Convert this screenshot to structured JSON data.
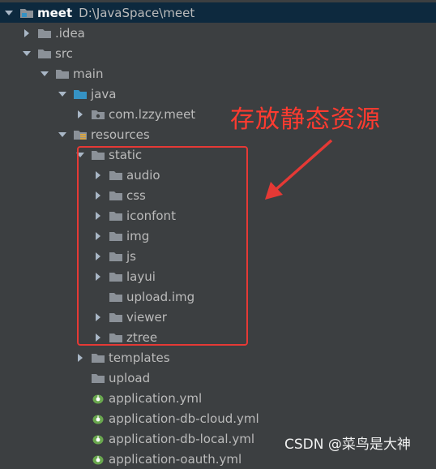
{
  "tree": {
    "items": [
      {
        "label": "meet",
        "path": "D:\\JavaSpace\\meet",
        "level": 0,
        "arrow": "down",
        "icon": "project-folder-icon",
        "root": true
      },
      {
        "label": ".idea",
        "level": 1,
        "arrow": "right",
        "icon": "folder-icon"
      },
      {
        "label": "src",
        "level": 1,
        "arrow": "down",
        "icon": "folder-icon"
      },
      {
        "label": "main",
        "level": 2,
        "arrow": "down",
        "icon": "folder-icon"
      },
      {
        "label": "java",
        "level": 3,
        "arrow": "down",
        "icon": "source-folder-icon"
      },
      {
        "label": "com.lzzy.meet",
        "level": 4,
        "arrow": "right",
        "icon": "package-icon"
      },
      {
        "label": "resources",
        "level": 3,
        "arrow": "down",
        "icon": "resources-folder-icon"
      },
      {
        "label": "static",
        "level": 4,
        "arrow": "down",
        "icon": "folder-icon"
      },
      {
        "label": "audio",
        "level": 5,
        "arrow": "right",
        "icon": "folder-icon"
      },
      {
        "label": "css",
        "level": 5,
        "arrow": "right",
        "icon": "folder-icon"
      },
      {
        "label": "iconfont",
        "level": 5,
        "arrow": "right",
        "icon": "folder-icon"
      },
      {
        "label": "img",
        "level": 5,
        "arrow": "right",
        "icon": "folder-icon"
      },
      {
        "label": "js",
        "level": 5,
        "arrow": "right",
        "icon": "folder-icon"
      },
      {
        "label": "layui",
        "level": 5,
        "arrow": "right",
        "icon": "folder-icon"
      },
      {
        "label": "upload.img",
        "level": 5,
        "arrow": "none",
        "icon": "folder-icon"
      },
      {
        "label": "viewer",
        "level": 5,
        "arrow": "right",
        "icon": "folder-icon"
      },
      {
        "label": "ztree",
        "level": 5,
        "arrow": "right",
        "icon": "folder-icon"
      },
      {
        "label": "templates",
        "level": 4,
        "arrow": "right",
        "icon": "folder-icon"
      },
      {
        "label": "upload",
        "level": 4,
        "arrow": "none",
        "icon": "folder-icon"
      },
      {
        "label": "application.yml",
        "level": 4,
        "arrow": "none",
        "icon": "spring-yml-icon"
      },
      {
        "label": "application-db-cloud.yml",
        "level": 4,
        "arrow": "none",
        "icon": "spring-yml-icon"
      },
      {
        "label": "application-db-local.yml",
        "level": 4,
        "arrow": "none",
        "icon": "spring-yml-icon"
      },
      {
        "label": "application-oauth.yml",
        "level": 4,
        "arrow": "none",
        "icon": "spring-yml-icon"
      }
    ]
  },
  "annotation": {
    "text": "存放静态资源",
    "color": "#ff3b30"
  },
  "watermark": {
    "text": "CSDN @菜鸟是大神"
  },
  "colors": {
    "background": "#3c3f41",
    "selected_row": "#0d293e",
    "text": "#bbbbbb",
    "folder": "#8b9198",
    "source_folder": "#3592c4",
    "resources_bar": "#e3a837",
    "spring_leaf": "#6aa84f",
    "highlight_box": "#e53935"
  }
}
